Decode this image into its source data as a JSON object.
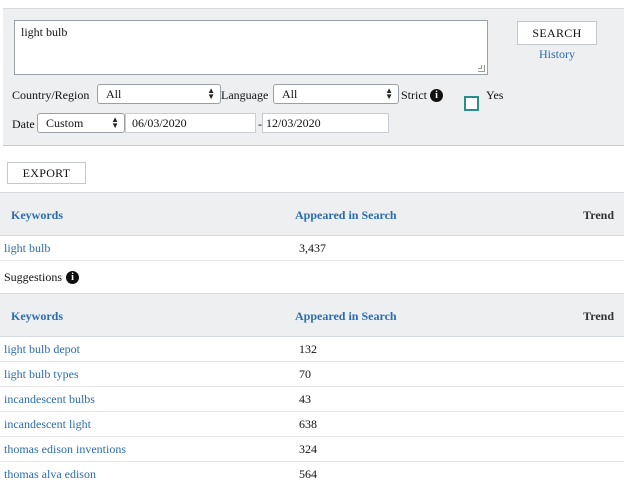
{
  "search": {
    "query": "light bulb",
    "button_label": "SEARCH",
    "history_label": "History"
  },
  "filters": {
    "country_label": "Country/Region",
    "country_value": "All",
    "language_label": "Language",
    "language_value": "All",
    "strict_label": "Strict",
    "yes_label": "Yes",
    "date_label": "Date",
    "date_value": "Custom",
    "date_from": "06/03/2020",
    "date_sep": "-",
    "date_to": "12/03/2020"
  },
  "export_label": "EXPORT",
  "table_headers": {
    "keywords": "Keywords",
    "appeared": "Appeared in Search",
    "trend": "Trend"
  },
  "main_result": {
    "keyword": "light bulb",
    "count": "3,437"
  },
  "suggestions_label": "Suggestions",
  "suggestions": [
    {
      "keyword": "light bulb depot",
      "count": "132"
    },
    {
      "keyword": "light bulb types",
      "count": "70"
    },
    {
      "keyword": "incandescent bulbs",
      "count": "43"
    },
    {
      "keyword": "incandescent light",
      "count": "638"
    },
    {
      "keyword": "thomas edison inventions",
      "count": "324"
    },
    {
      "keyword": "thomas alva edison",
      "count": "564"
    }
  ]
}
